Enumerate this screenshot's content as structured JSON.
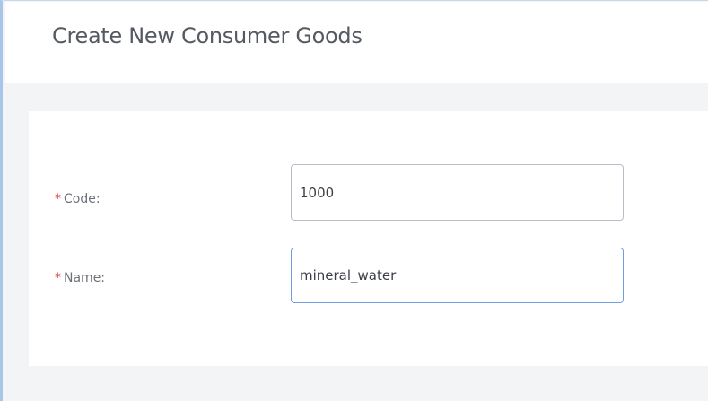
{
  "header": {
    "title": "Create New Consumer Goods"
  },
  "form": {
    "fields": [
      {
        "required_mark": "*",
        "label": "Code:",
        "value": "1000",
        "placeholder": ""
      },
      {
        "required_mark": "*",
        "label": "Name:",
        "value": "mineral_water",
        "placeholder": ""
      }
    ]
  },
  "colors": {
    "required": "#e64545",
    "focus_border": "#6f9ee3",
    "frame_accent": "#a9c6ea"
  }
}
